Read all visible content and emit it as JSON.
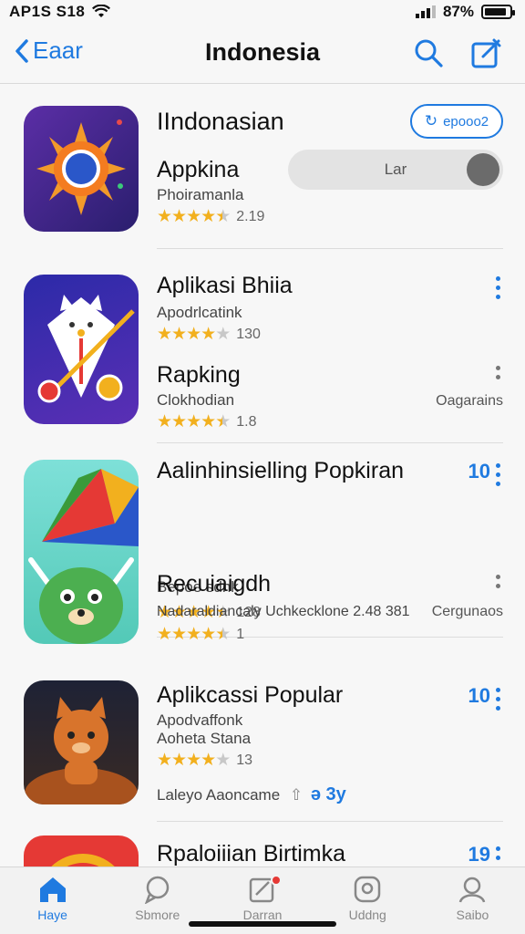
{
  "status_bar": {
    "carrier": "AP1S S18",
    "battery_percent": "87%",
    "battery_level": 0.87
  },
  "nav": {
    "back_label": "Eaar",
    "title": "Indonesia"
  },
  "rows": [
    {
      "name": "IIndonasian",
      "button_label": "epooo2",
      "subtitle": "Appkina",
      "developer": "Phoiramanla",
      "rating_count": "2.19",
      "rating": 4.5,
      "toggle_label": "Lar"
    },
    {
      "name": "Aplikasi Bhiia",
      "developer": "Apodrlcatink",
      "rating_count": "130",
      "rating": 4,
      "sub_name": "Rapking",
      "sub_developer": "Clokhodian",
      "sub_rating_count": "1.8",
      "sub_rating": 4.5,
      "side_text": "Oagarains"
    },
    {
      "name": "Aalinhinsielling Popkiran",
      "number": "10",
      "developer": "Bepoe sdnk",
      "rating_count": "128",
      "rating": 4.5,
      "sub_name": "Recuiaigdh",
      "sub_developer": "Nadaraldiancaly Uchkecklone 2.48 381",
      "sub_side_text": "Cergunaos",
      "sub_rating_count": "1",
      "sub_rating": 4.5
    },
    {
      "name": "Aplikcassi Popular",
      "number": "10",
      "developer": "Apodvaffonk",
      "developer2": "Aoheta Stana",
      "rating_count": "13",
      "rating": 4,
      "footer_text": "Laleyo Aaoncame",
      "footer_link": "ə 3y"
    },
    {
      "name": "Rpaloiiian Birtimka",
      "number": "19"
    }
  ],
  "tabs": [
    {
      "label": "Haye",
      "icon": "home-icon"
    },
    {
      "label": "Sbmore",
      "icon": "chat-icon"
    },
    {
      "label": "Darran",
      "icon": "edit-icon"
    },
    {
      "label": "Uddng",
      "icon": "update-icon"
    },
    {
      "label": "Saibo",
      "icon": "profile-icon"
    }
  ],
  "colors": {
    "accent": "#1f7ae0",
    "star": "#f2b01e"
  }
}
